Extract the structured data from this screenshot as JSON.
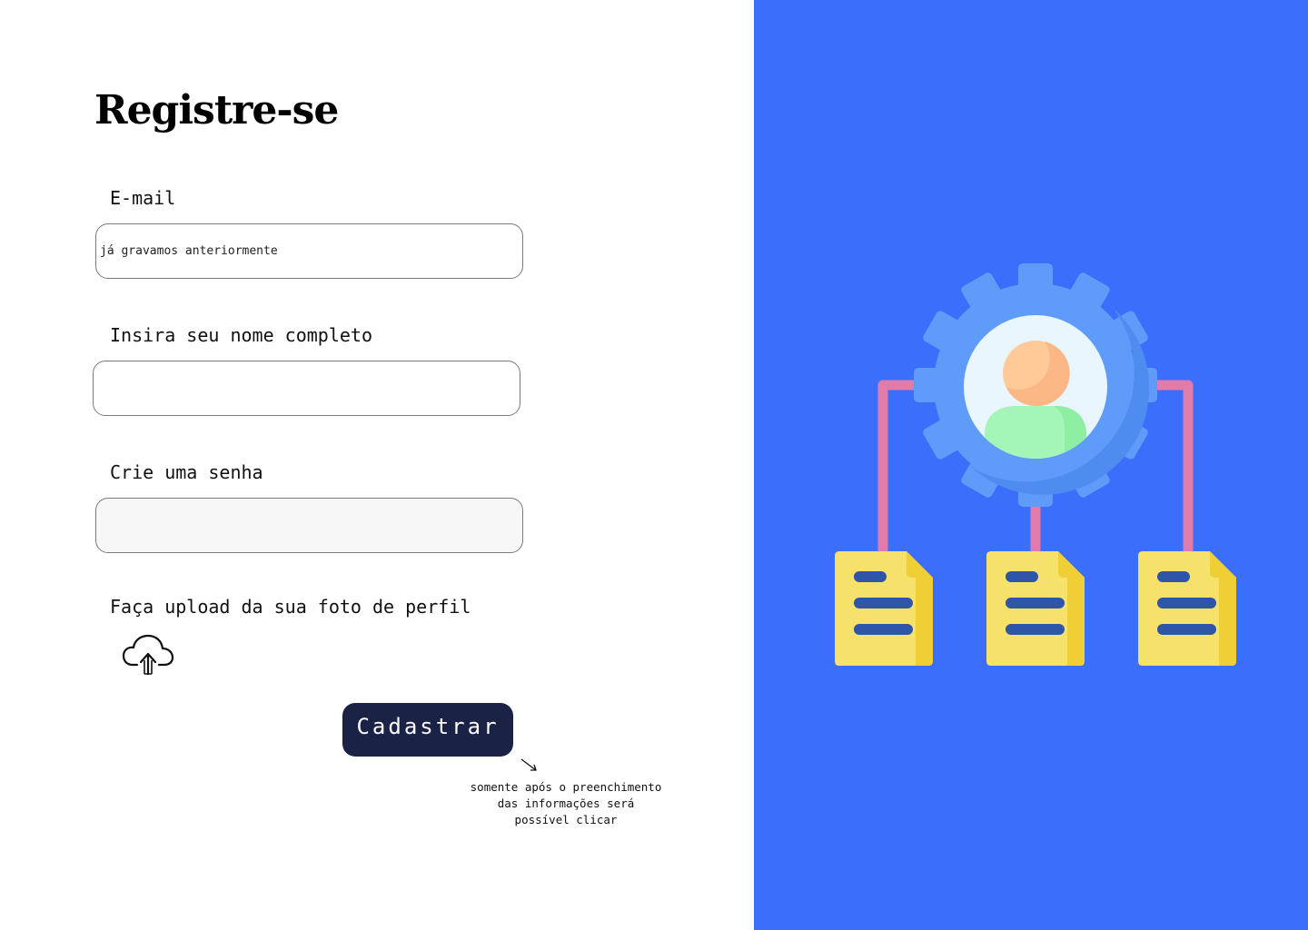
{
  "form": {
    "title": "Registre-se",
    "email": {
      "label": "E-mail",
      "value": "",
      "placeholder": "já gravamos anteriormente"
    },
    "name": {
      "label": "Insira seu nome completo",
      "value": "",
      "placeholder": ""
    },
    "password": {
      "label": "Crie uma senha",
      "value": "",
      "placeholder": ""
    },
    "upload": {
      "label": "Faça upload da sua foto de perfil",
      "icon": "cloud-upload-icon"
    },
    "submit_label": "Cadastrar",
    "submit_note": "somente após o preenchimento\ndas informações será\npossível clicar"
  },
  "illustration": {
    "icons": [
      "gear-icon",
      "user-avatar-icon",
      "document-icon"
    ],
    "colors": {
      "panel_bg": "#3A6EFB",
      "gear": "#5F9CFA",
      "connector": "#E07BAA",
      "document": "#F6E26A",
      "document_lines": "#2E55A8",
      "avatar_head": "#FFC998",
      "avatar_body": "#A4F5B8"
    }
  },
  "colors": {
    "button_bg": "#1A2245",
    "button_text": "#FFFFFF",
    "field_border": "#7A7A7A"
  }
}
